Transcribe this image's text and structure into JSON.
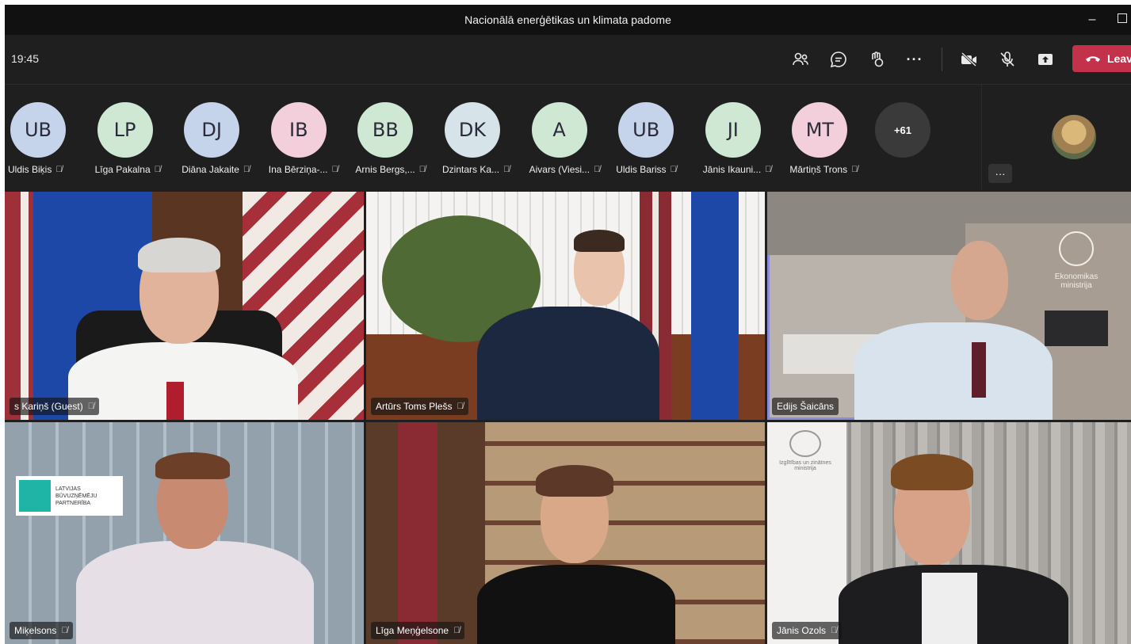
{
  "window": {
    "title": "Nacionālā enerģētikas un klimata padome"
  },
  "toolbar": {
    "time": "19:45",
    "leave_label": "Leav"
  },
  "roster": [
    {
      "initials": "UB",
      "name": "Uldis Biķis",
      "color": "#c5d4ea"
    },
    {
      "initials": "LP",
      "name": "Līga Pakalna",
      "color": "#cfe8d3"
    },
    {
      "initials": "DJ",
      "name": "Diāna Jakaite",
      "color": "#c5d4ea"
    },
    {
      "initials": "IB",
      "name": "Ina Bērziņa-...",
      "color": "#f3cfdc"
    },
    {
      "initials": "BB",
      "name": "Arnis Bergs,...",
      "color": "#cfe8d3"
    },
    {
      "initials": "DK",
      "name": "Dzintars Ka...",
      "color": "#d6e3e8"
    },
    {
      "initials": "A",
      "name": "Aivars (Viesi...",
      "color": "#cfe8d3"
    },
    {
      "initials": "UB",
      "name": "Uldis Bariss",
      "color": "#c5d4ea"
    },
    {
      "initials": "JI",
      "name": "Jānis Ikauni...",
      "color": "#cfe8d3"
    },
    {
      "initials": "MT",
      "name": "Mārtiņš Trons",
      "color": "#f3cfdc"
    }
  ],
  "roster_more": "+61",
  "tiles": [
    {
      "name": "s Kariņš (Guest)"
    },
    {
      "name": "Artūrs Toms Plešs"
    },
    {
      "name": "Edijs Šaicāns",
      "logo_text": "Ekonomikas ministrija"
    },
    {
      "name": "Miķelsons",
      "logo_text": "LATVIJAS BŪVUZŅĒMĒJU PARTNERĪBA"
    },
    {
      "name": "Līga Meņģelsone"
    },
    {
      "name": "Jānis Ozols",
      "logo_text": "Izglītības un zinātnes ministrija"
    }
  ],
  "colors": {
    "leave": "#c4314b",
    "active_border": "#8b8cd9"
  }
}
